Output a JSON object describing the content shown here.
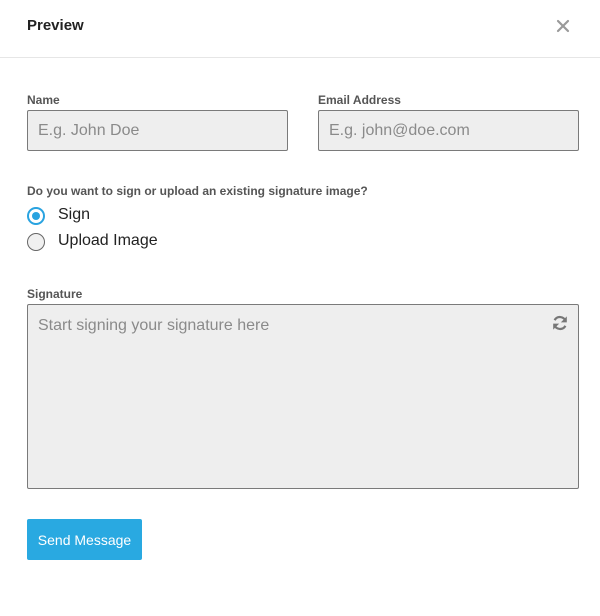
{
  "header": {
    "title": "Preview",
    "close_icon": "close-icon"
  },
  "form": {
    "name": {
      "label": "Name",
      "placeholder": "E.g. John Doe",
      "value": ""
    },
    "email": {
      "label": "Email Address",
      "placeholder": "E.g. john@doe.com",
      "value": ""
    },
    "signature_choice": {
      "question": "Do you want to sign or upload an existing signature image?",
      "options": [
        {
          "label": "Sign",
          "selected": true
        },
        {
          "label": "Upload Image",
          "selected": false
        }
      ]
    },
    "signature": {
      "label": "Signature",
      "placeholder": "Start signing your signature here",
      "reset_icon": "refresh-icon"
    },
    "submit_label": "Send Message"
  },
  "colors": {
    "accent": "#29a9e1",
    "field_background": "#eeeeee",
    "field_border": "#7a7a7a"
  }
}
